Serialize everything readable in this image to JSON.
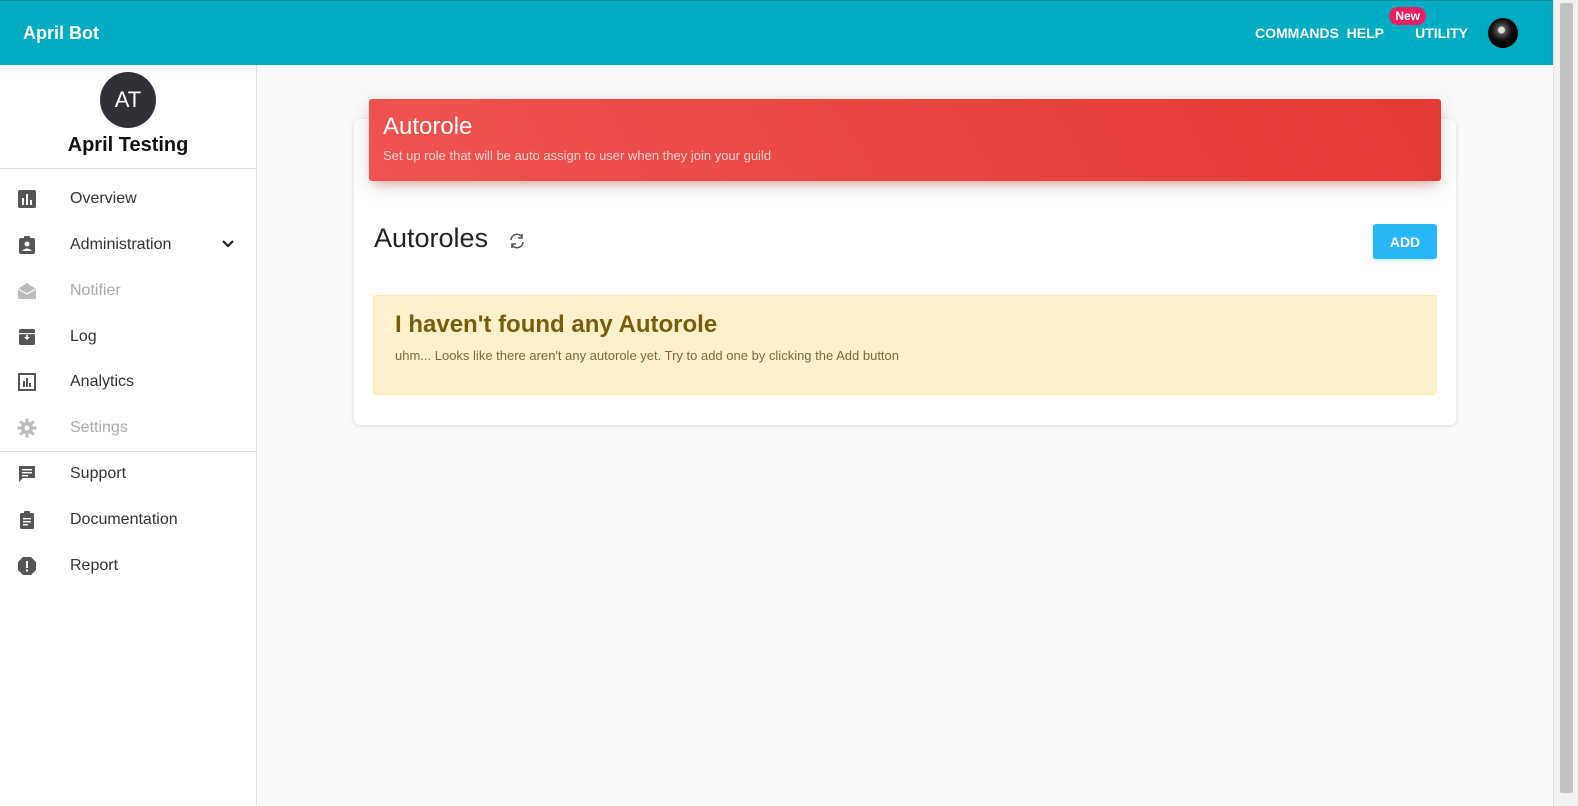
{
  "topbar": {
    "brand": "April Bot",
    "nav": {
      "commands": "COMMANDS",
      "help": "HELP",
      "utility": "UTILITY",
      "new_badge": "New"
    },
    "colors": {
      "bar": "#00acc1",
      "badge": "#e91e63"
    }
  },
  "sidebar": {
    "guild_avatar_text": "AT",
    "guild_name": "April Testing",
    "items": [
      {
        "label": "Overview",
        "icon": "bar-chart-icon",
        "disabled": false
      },
      {
        "label": "Administration",
        "icon": "clipboard-account-icon",
        "disabled": false,
        "expandable": true
      },
      {
        "label": "Notifier",
        "icon": "envelope-open-icon",
        "disabled": true
      },
      {
        "label": "Log",
        "icon": "archive-icon",
        "disabled": false
      },
      {
        "label": "Analytics",
        "icon": "analytics-icon",
        "disabled": false
      },
      {
        "label": "Settings",
        "icon": "gear-icon",
        "disabled": true
      }
    ],
    "secondary_items": [
      {
        "label": "Support",
        "icon": "chat-icon"
      },
      {
        "label": "Documentation",
        "icon": "document-icon"
      },
      {
        "label": "Report",
        "icon": "report-icon"
      }
    ]
  },
  "main": {
    "card_title": "Autorole",
    "card_subtitle": "Set up role that will be auto assign to user when they join your guild",
    "section_title": "Autoroles",
    "add_label": "ADD",
    "alert": {
      "title": "I haven't found any Autorole",
      "text": "uhm... Looks like there aren't any autorole yet. Try to add one by clicking the Add button"
    },
    "colors": {
      "header": "#e53935",
      "add_button": "#29b6f6",
      "alert_bg": "#fff1cc"
    }
  }
}
